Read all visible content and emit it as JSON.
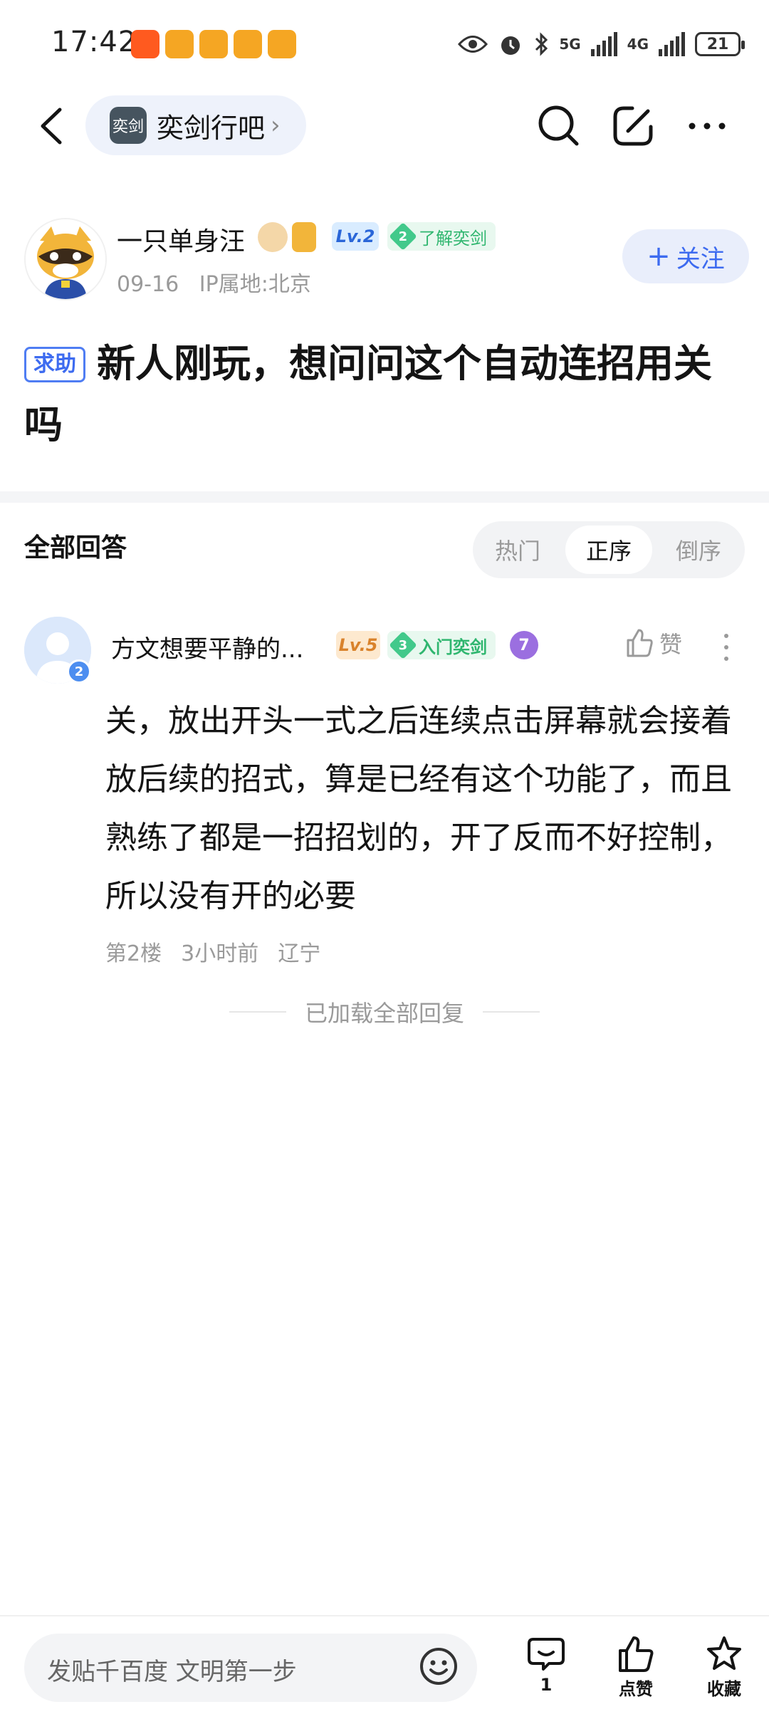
{
  "status_bar": {
    "time": "17:42",
    "network_5g": "5G",
    "network_4g": "4G",
    "battery": "21"
  },
  "nav": {
    "forum_name": "奕剑行吧",
    "forum_logo_text": "奕剑"
  },
  "post": {
    "author_name": "一只单身汪",
    "author_level": "Lv.2",
    "author_title_level": "2",
    "author_title": "了解奕剑",
    "date": "09-16",
    "ip_location": "IP属地:北京",
    "follow_label": "关注",
    "tag": "求助",
    "title": "新人刚玩，想问问这个自动连招用关吗"
  },
  "answers": {
    "header": "全部回答",
    "sort_tabs": [
      "热门",
      "正序",
      "倒序"
    ],
    "active_tab": "正序"
  },
  "reply": {
    "author_name": "方文想要平静的...",
    "avatar_badge": "2",
    "level": "Lv.5",
    "title_level": "3",
    "title": "入门奕剑",
    "extra_badge": "7",
    "like_label": "赞",
    "content": "关，放出开头一式之后连续点击屏幕就会接着放后续的招式，算是已经有这个功能了，而且熟练了都是一招招划的，开了反而不好控制，所以没有开的必要",
    "floor": "第2楼",
    "time": "3小时前",
    "location": "辽宁"
  },
  "loaded_text": "已加载全部回复",
  "bottom_bar": {
    "input_placeholder": "发贴千百度 文明第一步",
    "comment_count": "1",
    "like_label": "点赞",
    "favorite_label": "收藏"
  },
  "colors": {
    "accent_blue": "#3d6bf0",
    "badge_green": "#42c98b",
    "level_bg": "#fde9cf",
    "muted_text": "#9a9a9a"
  }
}
